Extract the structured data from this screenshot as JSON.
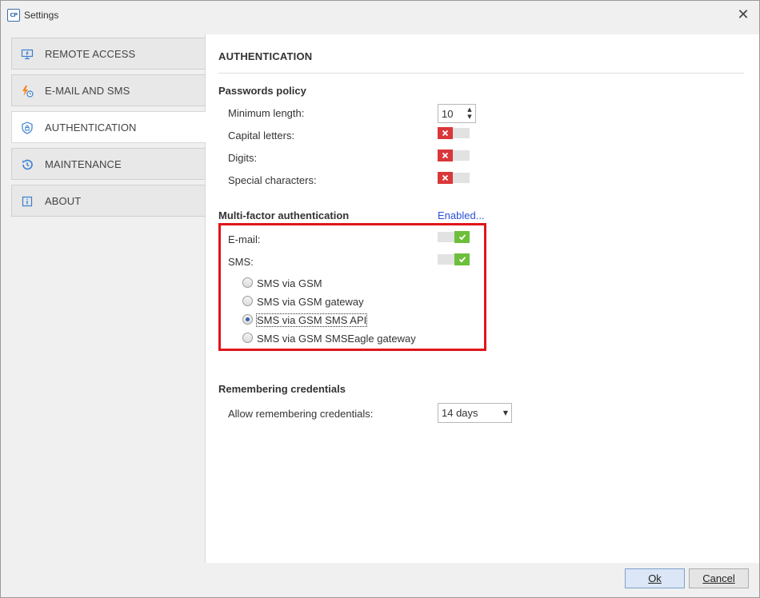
{
  "window": {
    "title": "Settings",
    "app_icon_text": "CP"
  },
  "sidebar": {
    "items": [
      {
        "label": "REMOTE ACCESS",
        "icon": "monitor-icon"
      },
      {
        "label": "E-MAIL AND SMS",
        "icon": "bolt-clock-icon"
      },
      {
        "label": "AUTHENTICATION",
        "icon": "shield-lock-icon",
        "active": true
      },
      {
        "label": "MAINTENANCE",
        "icon": "history-icon"
      },
      {
        "label": "ABOUT",
        "icon": "info-icon"
      }
    ]
  },
  "content": {
    "title": "AUTHENTICATION",
    "passwords_policy": {
      "title": "Passwords policy",
      "min_length_label": "Minimum length:",
      "min_length_value": "10",
      "capital_letters_label": "Capital letters:",
      "capital_letters_enabled": false,
      "digits_label": "Digits:",
      "digits_enabled": false,
      "special_chars_label": "Special characters:",
      "special_chars_enabled": false
    },
    "mfa": {
      "title": "Multi-factor authentication",
      "link": "Enabled...",
      "email_label": "E-mail:",
      "email_enabled": true,
      "sms_label": "SMS:",
      "sms_enabled": true,
      "sms_options": [
        "SMS via GSM",
        "SMS via GSM gateway",
        "SMS via GSM SMS API",
        "SMS via GSM SMSEagle gateway"
      ],
      "sms_selected": "SMS via GSM SMS API"
    },
    "remembering": {
      "title": "Remembering credentials",
      "allow_label": "Allow remembering credentials:",
      "allow_value": "14 days"
    }
  },
  "footer": {
    "ok_label": "Ok",
    "cancel_label": "Cancel"
  },
  "colors": {
    "toggle_off": "#d9373a",
    "toggle_on": "#6cbf3a",
    "highlight": "#e0151b",
    "link": "#2a4fd6"
  }
}
